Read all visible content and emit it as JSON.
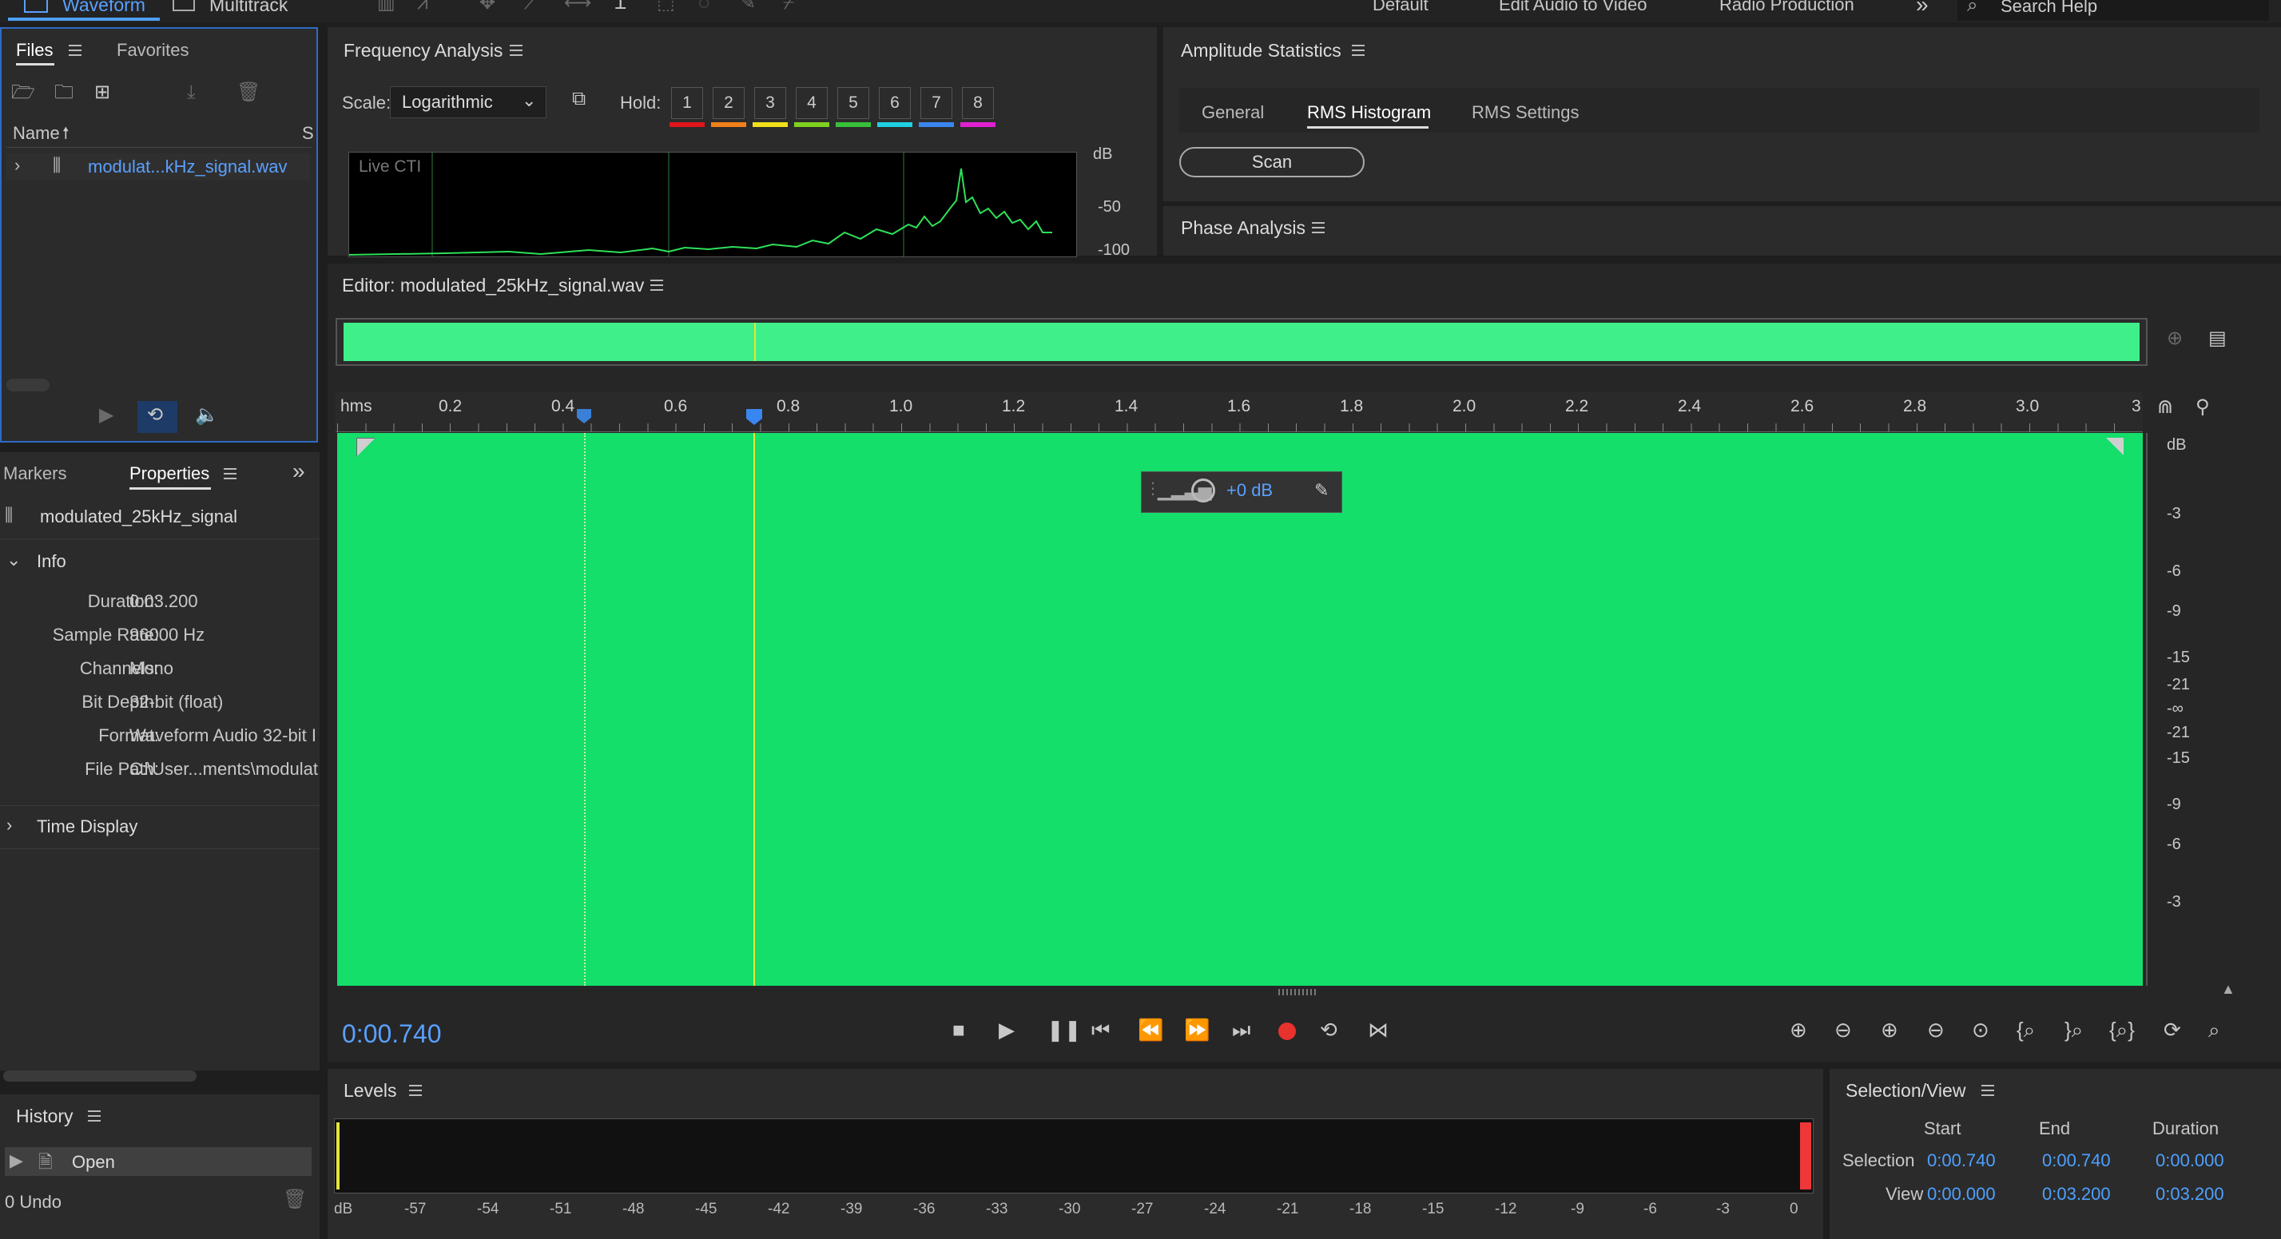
{
  "top": {
    "workspace_tabs": [
      "Waveform",
      "Multitrack"
    ],
    "workspaces": [
      "Default",
      "Edit Audio to Video",
      "Radio Production"
    ],
    "more": "»",
    "search_placeholder": "Search Help"
  },
  "files": {
    "tabs": [
      "Files",
      "Favorites"
    ],
    "col_name": "Name",
    "col_s": "S",
    "file": "modulat...kHz_signal.wav"
  },
  "freq": {
    "title": "Frequency Analysis",
    "scale_label": "Scale:",
    "scale_value": "Logarithmic",
    "hold_label": "Hold:",
    "holds": [
      "1",
      "2",
      "3",
      "4",
      "5",
      "6",
      "7",
      "8"
    ],
    "live": "Live CTI",
    "db": [
      "dB",
      "-50",
      "-100"
    ]
  },
  "amp": {
    "title": "Amplitude Statistics",
    "tabs": [
      "General",
      "RMS Histogram",
      "RMS Settings"
    ],
    "scan": "Scan",
    "phase": "Phase Analysis"
  },
  "editor": {
    "title": "Editor: modulated_25kHz_signal.wav",
    "ruler_unit": "hms",
    "ticks": [
      "0.2",
      "0.4",
      "0.6",
      "0.8",
      "1.0",
      "1.2",
      "1.4",
      "1.6",
      "1.8",
      "2.0",
      "2.2",
      "2.4",
      "2.6",
      "2.8",
      "3.0",
      "3"
    ],
    "hud_gain": "+0 dB",
    "db_scale": [
      "dB",
      "-3",
      "-6",
      "-9",
      "-15",
      "-21",
      "-∞",
      "-21",
      "-15",
      "-9",
      "-6",
      "-3"
    ],
    "time": "0:00.740"
  },
  "props": {
    "side_tabs": [
      "Markers",
      "Properties"
    ],
    "name": "modulated_25kHz_signal",
    "info": "Info",
    "rows": [
      {
        "k": "Duration:",
        "v": "0:03.200"
      },
      {
        "k": "Sample Rate:",
        "v": "96000 Hz"
      },
      {
        "k": "Channels:",
        "v": "Mono"
      },
      {
        "k": "Bit Depth:",
        "v": "32-bit (float)"
      },
      {
        "k": "Format:",
        "v": "Waveform Audio 32-bit I"
      },
      {
        "k": "File Path:",
        "v": "C:\\User...ments\\modulat"
      }
    ],
    "time_display": "Time Display"
  },
  "history": {
    "title": "History",
    "item": "Open",
    "undo": "0 Undo"
  },
  "levels": {
    "title": "Levels",
    "scale": [
      "dB",
      "-57",
      "-54",
      "-51",
      "-48",
      "-45",
      "-42",
      "-39",
      "-36",
      "-33",
      "-30",
      "-27",
      "-24",
      "-21",
      "-18",
      "-15",
      "-12",
      "-9",
      "-6",
      "-3",
      "0"
    ]
  },
  "selview": {
    "title": "Selection/View",
    "headers": [
      "Start",
      "End",
      "Duration"
    ],
    "rows": [
      {
        "label": "Selection",
        "start": "0:00.740",
        "end": "0:00.740",
        "dur": "0:00.000"
      },
      {
        "label": "View",
        "start": "0:00.000",
        "end": "0:03.200",
        "dur": "0:03.200"
      }
    ]
  },
  "colors": {
    "waveform": "#13df6a",
    "overview": "#3ff08a",
    "accent": "#4ea0ff",
    "playhead": "#e6e63a",
    "hold": [
      "#e0161a",
      "#f0801a",
      "#f0e01a",
      "#80d020",
      "#38c038",
      "#20d0e0",
      "#3a86f0",
      "#e020d0"
    ]
  }
}
